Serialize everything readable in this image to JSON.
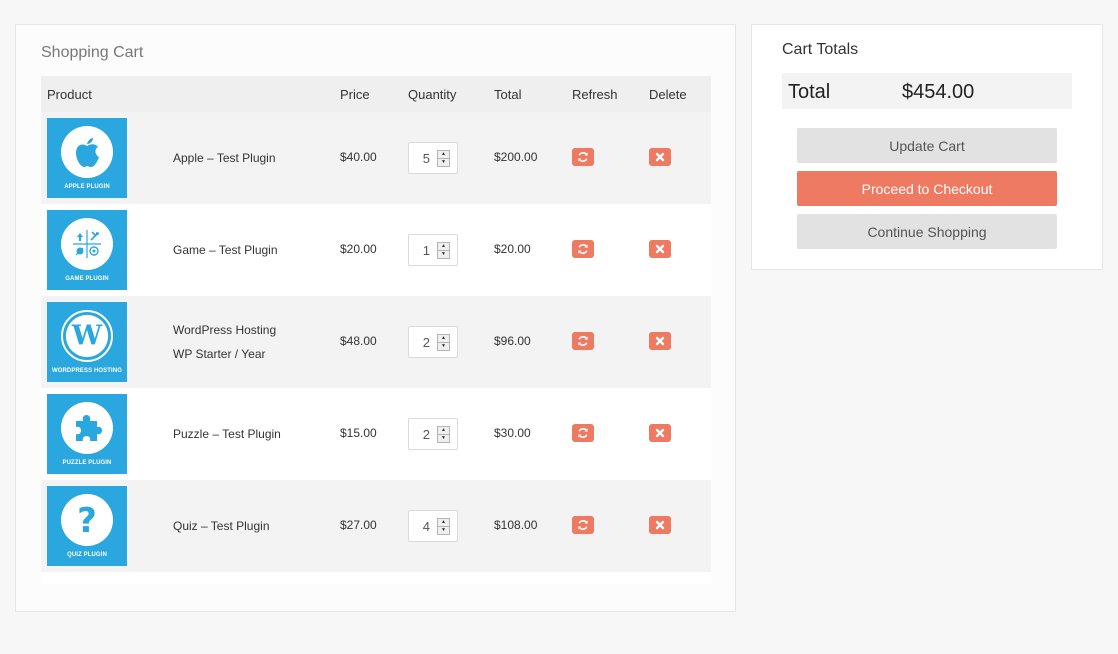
{
  "cart": {
    "title": "Shopping Cart",
    "columns": {
      "product": "Product",
      "price": "Price",
      "quantity": "Quantity",
      "total": "Total",
      "refresh": "Refresh",
      "delete": "Delete"
    },
    "items": [
      {
        "caption": "APPLE PLUGIN",
        "name_line1": "Apple – Test Plugin",
        "name_line2": "",
        "price": "$40.00",
        "quantity": "5",
        "total": "$200.00",
        "icon": "apple-icon"
      },
      {
        "caption": "GAME PLUGIN",
        "name_line1": "Game – Test Plugin",
        "name_line2": "",
        "price": "$20.00",
        "quantity": "1",
        "total": "$20.00",
        "icon": "game-icon"
      },
      {
        "caption": "WORDPRESS HOSTING",
        "name_line1": "WordPress Hosting",
        "name_line2": "WP Starter / Year",
        "price": "$48.00",
        "quantity": "2",
        "total": "$96.00",
        "icon": "wordpress-icon"
      },
      {
        "caption": "PUZZLE PLUGIN",
        "name_line1": "Puzzle – Test Plugin",
        "name_line2": "",
        "price": "$15.00",
        "quantity": "2",
        "total": "$30.00",
        "icon": "puzzle-icon"
      },
      {
        "caption": "QUIZ PLUGIN",
        "name_line1": "Quiz – Test Plugin",
        "name_line2": "",
        "price": "$27.00",
        "quantity": "4",
        "total": "$108.00",
        "icon": "question-icon"
      }
    ]
  },
  "totals": {
    "title": "Cart Totals",
    "label": "Total",
    "value": "$454.00",
    "update_label": "Update Cart",
    "checkout_label": "Proceed to Checkout",
    "continue_label": "Continue Shopping"
  },
  "colors": {
    "accent": "#ee7a62",
    "thumb_blue": "#2aa7df"
  }
}
